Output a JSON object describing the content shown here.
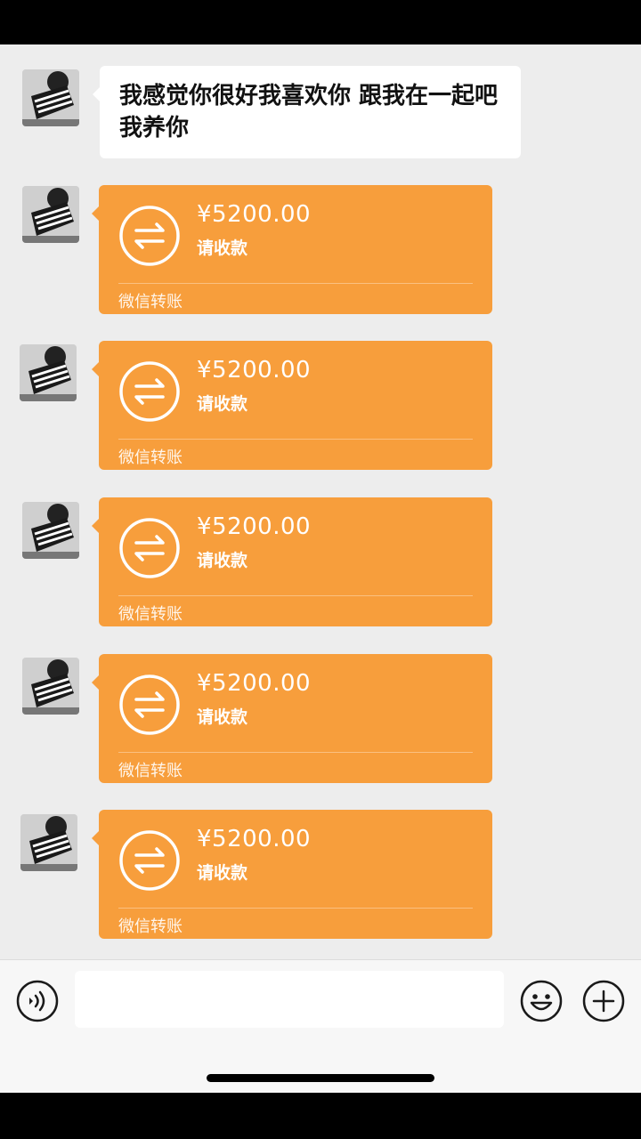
{
  "messages": [
    {
      "type": "text",
      "text": "我感觉你很好我喜欢你 跟我在一起吧我养你"
    }
  ],
  "transfers": [
    {
      "amount": "¥5200.00",
      "status": "请收款",
      "brand": "微信转账"
    },
    {
      "amount": "¥5200.00",
      "status": "请收款",
      "brand": "微信转账"
    },
    {
      "amount": "¥5200.00",
      "status": "请收款",
      "brand": "微信转账"
    },
    {
      "amount": "¥5200.00",
      "status": "请收款",
      "brand": "微信转账"
    },
    {
      "amount": "¥5200.00",
      "status": "请收款",
      "brand": "微信转账"
    }
  ],
  "colors": {
    "chat_background": "#ededed",
    "transfer_orange": "#f79e3c",
    "bubble_white": "#ffffff"
  },
  "icons": {
    "transfer": "transfer-arrows-icon",
    "voice": "voice-icon",
    "emoji": "emoji-icon",
    "plus": "plus-icon"
  }
}
